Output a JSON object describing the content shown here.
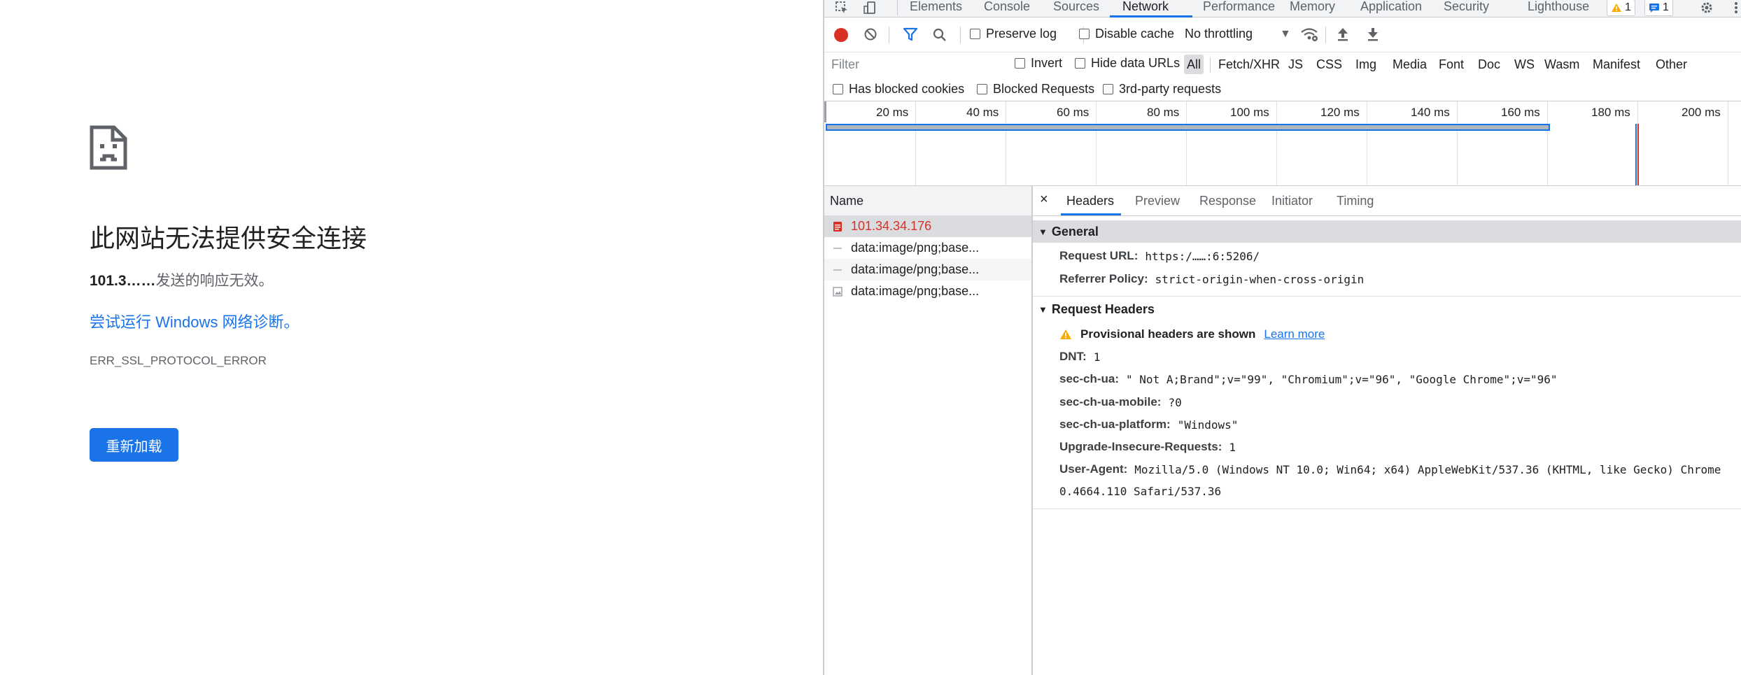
{
  "error_page": {
    "title": "此网站无法提供安全连接",
    "subtitle_host": "101.3……",
    "subtitle_text": "发送的响应无效。",
    "diagnose_link": "尝试运行 Windows 网络诊断。",
    "error_code": "ERR_SSL_PROTOCOL_ERROR",
    "reload_label": "重新加载"
  },
  "devtools": {
    "tabs": [
      "Elements",
      "Console",
      "Sources",
      "Network",
      "Performance",
      "Memory",
      "Application",
      "Security",
      "Lighthouse"
    ],
    "active_tab": "Network",
    "warnings_count": "1",
    "messages_count": "1",
    "toolbar": {
      "preserve_log": "Preserve log",
      "disable_cache": "Disable cache",
      "throttling": "No throttling"
    },
    "filter": {
      "placeholder": "Filter",
      "invert": "Invert",
      "hide_data_urls": "Hide data URLs",
      "types": [
        "All",
        "Fetch/XHR",
        "JS",
        "CSS",
        "Img",
        "Media",
        "Font",
        "Doc",
        "WS",
        "Wasm",
        "Manifest",
        "Other"
      ],
      "active_type": "All",
      "has_blocked_cookies": "Has blocked cookies",
      "blocked_requests": "Blocked Requests",
      "third_party": "3rd-party requests"
    },
    "timeline_ticks": [
      "20 ms",
      "40 ms",
      "60 ms",
      "80 ms",
      "100 ms",
      "120 ms",
      "140 ms",
      "160 ms",
      "180 ms",
      "200 ms"
    ],
    "name_column": "Name",
    "requests": [
      {
        "name": "101.34.34.176",
        "status": "error"
      },
      {
        "name": "data:image/png;base...",
        "status": "ok"
      },
      {
        "name": "data:image/png;base...",
        "status": "ok"
      },
      {
        "name": "data:image/png;base...",
        "status": "ok"
      }
    ],
    "detail_tabs": [
      "Headers",
      "Preview",
      "Response",
      "Initiator",
      "Timing"
    ],
    "active_detail_tab": "Headers",
    "general": {
      "heading": "General",
      "request_url_label": "Request URL:",
      "request_url_value": "https:/……:6:5206/",
      "referrer_policy_label": "Referrer Policy:",
      "referrer_policy_value": "strict-origin-when-cross-origin"
    },
    "request_headers": {
      "heading": "Request Headers",
      "provisional_msg": "Provisional headers are shown",
      "learn_more": "Learn more",
      "items": [
        {
          "key": "DNT:",
          "value": "1"
        },
        {
          "key": "sec-ch-ua:",
          "value": "\" Not A;Brand\";v=\"99\", \"Chromium\";v=\"96\", \"Google Chrome\";v=\"96\""
        },
        {
          "key": "sec-ch-ua-mobile:",
          "value": "?0"
        },
        {
          "key": "sec-ch-ua-platform:",
          "value": "\"Windows\""
        },
        {
          "key": "Upgrade-Insecure-Requests:",
          "value": "1"
        },
        {
          "key": "User-Agent:",
          "value": "Mozilla/5.0 (Windows NT 10.0; Win64; x64) AppleWebKit/537.36 (KHTML, like Gecko) Chrome"
        }
      ],
      "user_agent_cont": "0.4664.110 Safari/537.36"
    },
    "colors": {
      "accent": "#1a73e8",
      "error": "#d93025",
      "warning": "#f9ab00"
    }
  }
}
